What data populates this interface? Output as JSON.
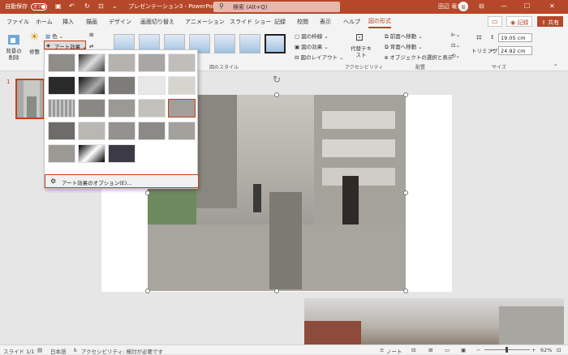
{
  "title_bar": {
    "autosave_label": "自動保存",
    "autosave_state": "オフ",
    "document_title": "プレゼンテーション3 - PowerPoint",
    "search_placeholder": "検索 (Alt+Q)",
    "user_name": "田辺 竜幸",
    "user_initials": "竜"
  },
  "tabs": [
    "ファイル",
    "ホーム",
    "挿入",
    "描画",
    "デザイン",
    "画面切り替え",
    "アニメーション",
    "スライド ショー",
    "記録",
    "校閲",
    "表示",
    "ヘルプ",
    "図の形式"
  ],
  "active_tab": "図の形式",
  "header_buttons": {
    "record": "記録",
    "share": "共有"
  },
  "ribbon": {
    "remove_bg": "背景の削除",
    "corrections": "修整",
    "color": "色",
    "art_effects": "アート効果",
    "styles_group": "図のスタイル",
    "border": "図の枠線",
    "effects": "図の効果",
    "layout": "図のレイアウト",
    "alt_text": "代替テキスト",
    "accessibility_group": "アクセシビリティ",
    "bring_forward": "前面へ移動",
    "send_backward": "背面へ移動",
    "selection_pane": "オブジェクトの選択と表示",
    "arrange_group": "配置",
    "crop": "トリミング",
    "height": "19.05 cm",
    "width": "24.92 cm",
    "size_group": "サイズ"
  },
  "art_effects_menu": {
    "gallery_count": 23,
    "options_label": "アート効果のオプション(E)..."
  },
  "slide_panel": {
    "slide_number": "1"
  },
  "status_bar": {
    "slide_info": "スライド 1/1",
    "language": "日本語",
    "accessibility": "アクセシビリティ: 検討が必要です",
    "notes": "ノート",
    "zoom": "62%"
  },
  "colors": {
    "accent": "#b7472a",
    "highlight": "#c43e1c"
  }
}
